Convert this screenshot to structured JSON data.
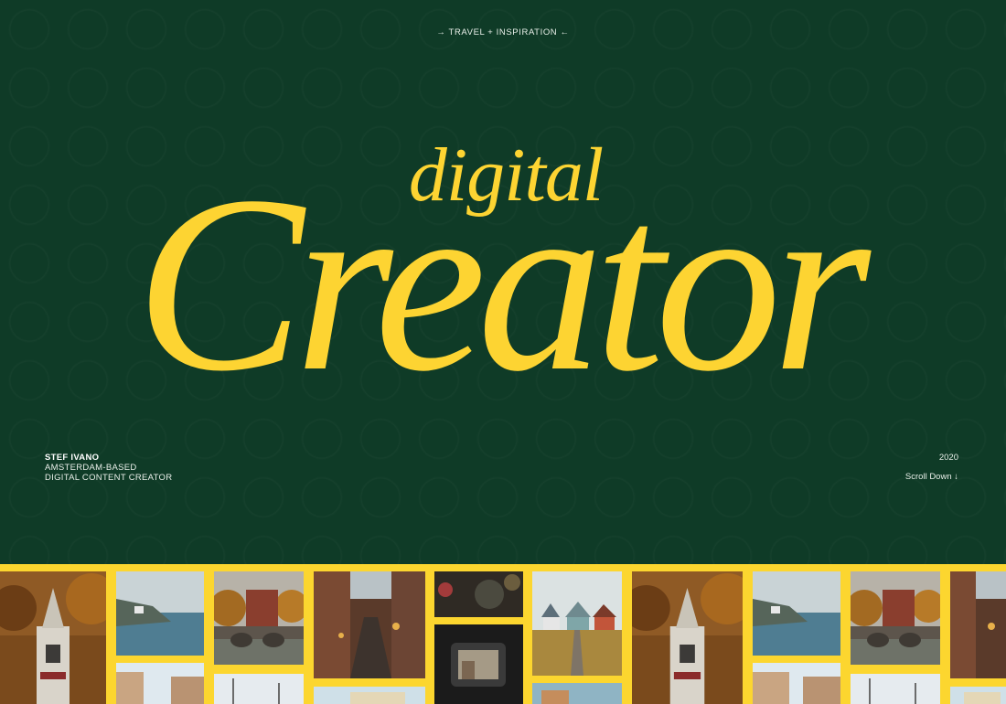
{
  "header": {
    "tagline": "→ TRAVEL + INSPIRATION ←"
  },
  "hero": {
    "line1": "digital",
    "line2": "Creator"
  },
  "author": {
    "name": "STEF IVANO",
    "line2": "AMSTERDAM-BASED",
    "line3": "DIGITAL CONTENT CREATOR"
  },
  "meta": {
    "year": "2020",
    "scroll_label": "Scroll Down ↓"
  },
  "colors": {
    "background": "#0f3b27",
    "accent": "#fdd432",
    "text": "#e9efe9"
  },
  "gallery": {
    "photos": [
      "church-photo",
      "sea-cliff-photo",
      "bridge-castle-photo",
      "rainy-street-photo",
      "lens-photo",
      "houses-pier-photo",
      "church-photo",
      "sea-cliff-photo",
      "bridge-castle-photo",
      "rainy-street-photo",
      "city-street-photo",
      "winter-trees-photo",
      "palace-photo",
      "camera-viewfinder-photo",
      "harbor-photo",
      "building-photo"
    ]
  }
}
